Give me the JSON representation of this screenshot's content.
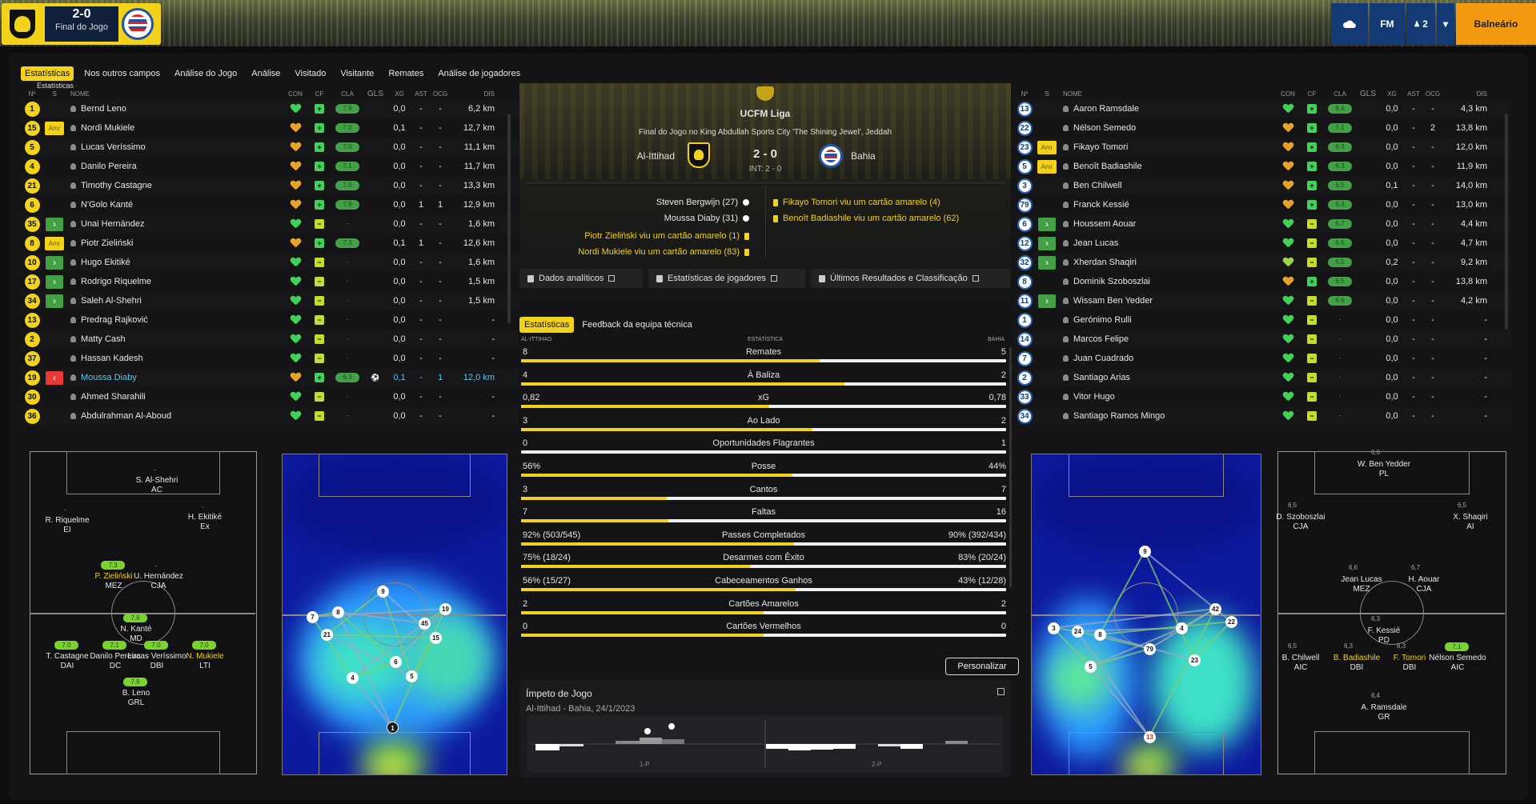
{
  "topbar": {
    "score": "2-0",
    "status": "Final do Jogo",
    "right_btn_fm": "FM",
    "right_btn_count": "2",
    "right_btn_locker": "Balneário"
  },
  "tabs": [
    "Estatísticas",
    "Nos outros campos",
    "Análise do Jogo",
    "Análise",
    "Visitado",
    "Visitante",
    "Remates",
    "Análise de jogadores"
  ],
  "table_title": "Estatísticas",
  "columns": [
    "Nº",
    "S",
    "NOME",
    "CON",
    "CF",
    "CLA",
    "GLS",
    "XG",
    "AST",
    "OCG",
    "DIS"
  ],
  "home_players": [
    {
      "no": "1",
      "s": "",
      "name": "Bernd Leno",
      "con": "g",
      "cf": "g",
      "cla": "7.9",
      "gls": "",
      "xg": "0,0",
      "ast": "-",
      "ocg": "-",
      "dis": "6,2 km"
    },
    {
      "no": "15",
      "s": "Amr",
      "name": "Nordi Mukiele",
      "con": "o",
      "cf": "g",
      "cla": "7.0",
      "gls": "",
      "xg": "0,1",
      "ast": "-",
      "ocg": "-",
      "dis": "12,7 km"
    },
    {
      "no": "5",
      "s": "",
      "name": "Lucas Veríssimo",
      "con": "o",
      "cf": "g",
      "cla": "7.0",
      "gls": "",
      "xg": "0,0",
      "ast": "-",
      "ocg": "-",
      "dis": "11,1 km"
    },
    {
      "no": "4",
      "s": "",
      "name": "Danilo Pereira",
      "con": "o",
      "cf": "g",
      "cla": "7.1",
      "gls": "",
      "xg": "0,0",
      "ast": "-",
      "ocg": "-",
      "dis": "11,7 km"
    },
    {
      "no": "21",
      "s": "",
      "name": "Timothy Castagne",
      "con": "o",
      "cf": "g",
      "cla": "7.0",
      "gls": "",
      "xg": "0,0",
      "ast": "-",
      "ocg": "-",
      "dis": "13,3 km"
    },
    {
      "no": "6",
      "s": "",
      "name": "N'Golo Kanté",
      "con": "o",
      "cf": "g",
      "cla": "7.9",
      "gls": "",
      "xg": "0,0",
      "ast": "1",
      "ocg": "1",
      "dis": "12,9 km"
    },
    {
      "no": "35",
      "s": "in",
      "name": "Unai Hernández",
      "con": "g",
      "cf": "y",
      "cla": "-",
      "gls": "",
      "xg": "0,0",
      "ast": "-",
      "ocg": "-",
      "dis": "1,6 km"
    },
    {
      "no": "8",
      "s": "Amr",
      "name": "Piotr Zieliński",
      "con": "o",
      "cf": "g",
      "cla": "7.3",
      "gls": "",
      "xg": "0,1",
      "ast": "1",
      "ocg": "-",
      "dis": "12,6 km"
    },
    {
      "no": "10",
      "s": "in",
      "name": "Hugo Ekitiké",
      "con": "g",
      "cf": "y",
      "cla": "-",
      "gls": "",
      "xg": "0,0",
      "ast": "-",
      "ocg": "-",
      "dis": "1,6 km"
    },
    {
      "no": "17",
      "s": "in",
      "name": "Rodrigo Riquelme",
      "con": "g",
      "cf": "y",
      "cla": "-",
      "gls": "",
      "xg": "0,0",
      "ast": "-",
      "ocg": "-",
      "dis": "1,5 km"
    },
    {
      "no": "34",
      "s": "in",
      "name": "Saleh Al-Shehri",
      "con": "g",
      "cf": "y",
      "cla": "-",
      "gls": "",
      "xg": "0,0",
      "ast": "-",
      "ocg": "-",
      "dis": "1,5 km"
    },
    {
      "no": "13",
      "s": "",
      "name": "Predrag Rajković",
      "con": "g",
      "cf": "y",
      "cla": "-",
      "gls": "",
      "xg": "0,0",
      "ast": "-",
      "ocg": "-",
      "dis": "-"
    },
    {
      "no": "2",
      "s": "",
      "name": "Matty Cash",
      "con": "g",
      "cf": "y",
      "cla": "-",
      "gls": "",
      "xg": "0,0",
      "ast": "-",
      "ocg": "-",
      "dis": "-"
    },
    {
      "no": "37",
      "s": "",
      "name": "Hassan Kadesh",
      "con": "g",
      "cf": "y",
      "cla": "-",
      "gls": "",
      "xg": "0,0",
      "ast": "-",
      "ocg": "-",
      "dis": "-"
    },
    {
      "no": "19",
      "s": "out",
      "name": "Moussa Diaby",
      "con": "o",
      "cf": "g",
      "cla": "6.3",
      "gls": "ball",
      "xg": "0,1",
      "ast": "-",
      "ocg": "1",
      "dis": "12,0 km",
      "hl": true
    },
    {
      "no": "30",
      "s": "",
      "name": "Ahmed Sharahili",
      "con": "g",
      "cf": "y",
      "cla": "-",
      "gls": "",
      "xg": "0,0",
      "ast": "-",
      "ocg": "-",
      "dis": "-"
    },
    {
      "no": "36",
      "s": "",
      "name": "Abdulrahman Al-Aboud",
      "con": "g",
      "cf": "y",
      "cla": "-",
      "gls": "",
      "xg": "0,0",
      "ast": "-",
      "ocg": "-",
      "dis": "-"
    }
  ],
  "away_players": [
    {
      "no": "13",
      "s": "",
      "name": "Aaron Ramsdale",
      "con": "g",
      "cf": "g",
      "cla": "6.4",
      "gls": "",
      "xg": "0,0",
      "ast": "-",
      "ocg": "-",
      "dis": "4,3 km"
    },
    {
      "no": "22",
      "s": "",
      "name": "Nélson Semedo",
      "con": "o",
      "cf": "g",
      "cla": "7.1",
      "gls": "",
      "xg": "0,0",
      "ast": "-",
      "ocg": "2",
      "dis": "13,8 km"
    },
    {
      "no": "23",
      "s": "Amr",
      "name": "Fikayo Tomori",
      "con": "o",
      "cf": "g",
      "cla": "6.3",
      "gls": "",
      "xg": "0,0",
      "ast": "-",
      "ocg": "-",
      "dis": "12,0 km"
    },
    {
      "no": "5",
      "s": "Amr",
      "name": "Benoît Badiashile",
      "con": "o",
      "cf": "g",
      "cla": "6.3",
      "gls": "",
      "xg": "0,0",
      "ast": "-",
      "ocg": "-",
      "dis": "11,9 km"
    },
    {
      "no": "3",
      "s": "",
      "name": "Ben Chilwell",
      "con": "o",
      "cf": "g",
      "cla": "6.5",
      "gls": "",
      "xg": "0,1",
      "ast": "-",
      "ocg": "-",
      "dis": "14,0 km"
    },
    {
      "no": "79",
      "s": "",
      "name": "Franck Kessié",
      "con": "o",
      "cf": "g",
      "cla": "6.3",
      "gls": "",
      "xg": "0,0",
      "ast": "-",
      "ocg": "-",
      "dis": "13,0 km"
    },
    {
      "no": "6",
      "s": "in",
      "name": "Houssem Aouar",
      "con": "g",
      "cf": "y",
      "cla": "6.7",
      "gls": "",
      "xg": "0,0",
      "ast": "-",
      "ocg": "-",
      "dis": "4,4 km"
    },
    {
      "no": "12",
      "s": "in",
      "name": "Jean Lucas",
      "con": "g",
      "cf": "y",
      "cla": "6.6",
      "gls": "",
      "xg": "0,0",
      "ast": "-",
      "ocg": "-",
      "dis": "4,7 km"
    },
    {
      "no": "32",
      "s": "in",
      "name": "Xherdan Shaqiri",
      "con": "lg",
      "cf": "y",
      "cla": "6.5",
      "gls": "",
      "xg": "0,2",
      "ast": "-",
      "ocg": "-",
      "dis": "9,2 km"
    },
    {
      "no": "8",
      "s": "",
      "name": "Dominik Szoboszlai",
      "con": "o",
      "cf": "g",
      "cla": "6.5",
      "gls": "",
      "xg": "0,0",
      "ast": "-",
      "ocg": "-",
      "dis": "13,8 km"
    },
    {
      "no": "11",
      "s": "in",
      "name": "Wissam Ben Yedder",
      "con": "g",
      "cf": "y",
      "cla": "6.6",
      "gls": "",
      "xg": "0,0",
      "ast": "-",
      "ocg": "-",
      "dis": "4,2 km"
    },
    {
      "no": "1",
      "s": "",
      "name": "Gerónimo Rulli",
      "con": "g",
      "cf": "y",
      "cla": "-",
      "gls": "",
      "xg": "0,0",
      "ast": "-",
      "ocg": "-",
      "dis": "-"
    },
    {
      "no": "14",
      "s": "",
      "name": "Marcos Felipe",
      "con": "g",
      "cf": "y",
      "cla": "-",
      "gls": "",
      "xg": "0,0",
      "ast": "-",
      "ocg": "-",
      "dis": "-"
    },
    {
      "no": "7",
      "s": "",
      "name": "Juan Cuadrado",
      "con": "g",
      "cf": "y",
      "cla": "-",
      "gls": "",
      "xg": "0,0",
      "ast": "-",
      "ocg": "-",
      "dis": "-"
    },
    {
      "no": "2",
      "s": "",
      "name": "Santiago Arias",
      "con": "g",
      "cf": "y",
      "cla": "-",
      "gls": "",
      "xg": "0,0",
      "ast": "-",
      "ocg": "-",
      "dis": "-"
    },
    {
      "no": "33",
      "s": "",
      "name": "Vitor Hugo",
      "con": "g",
      "cf": "y",
      "cla": "-",
      "gls": "",
      "xg": "0,0",
      "ast": "-",
      "ocg": "-",
      "dis": "-"
    },
    {
      "no": "34",
      "s": "",
      "name": "Santiago Ramos Mingo",
      "con": "g",
      "cf": "y",
      "cla": "-",
      "gls": "",
      "xg": "0,0",
      "ast": "-",
      "ocg": "-",
      "dis": "-"
    }
  ],
  "match": {
    "league": "UCFM Liga",
    "venue": "Final do Jogo no King Abdullah Sports City 'The Shining Jewel', Jeddah",
    "home": "Al-Ittihad",
    "away": "Bahia",
    "score": "2 - 0",
    "interval": "INT: 2 - 0",
    "events_home": [
      "Steven Bergwijn (27)",
      "Moussa Diaby (31)",
      "Piotr Zieliński viu um cartão amarelo (1)",
      "Nordi Mukiele viu um cartão amarelo (83)"
    ],
    "events_away": [
      "Fikayo Tomori viu um cartão amarelo (4)",
      "Benoît Badiashile viu um cartão amarelo (62)"
    ],
    "links": [
      "Dados analíticos",
      "Estatísticas de jogadores",
      "Últimos Resultados e Classificação"
    ]
  },
  "stats_tabs": [
    "Estatísticas",
    "Feedback da equipa técnica"
  ],
  "stats_head": {
    "home": "AL-ITTIHAD",
    "mid": "ESTATÍSTICA",
    "away": "BAHIA"
  },
  "stats": [
    {
      "label": "Remates",
      "home": "8",
      "away": "5",
      "share": 0.615
    },
    {
      "label": "À Baliza",
      "home": "4",
      "away": "2",
      "share": 0.667
    },
    {
      "label": "xG",
      "home": "0,82",
      "away": "0,78",
      "share": 0.512
    },
    {
      "label": "Ao Lado",
      "home": "3",
      "away": "2",
      "share": 0.6
    },
    {
      "label": "Oportunidades Flagrantes",
      "home": "0",
      "away": "1",
      "share": 0.0
    },
    {
      "label": "Posse",
      "home": "56%",
      "away": "44%",
      "share": 0.56
    },
    {
      "label": "Cantos",
      "home": "3",
      "away": "7",
      "share": 0.3
    },
    {
      "label": "Faltas",
      "home": "7",
      "away": "16",
      "share": 0.304
    },
    {
      "label": "Passes Completados",
      "home": "92% (503/545)",
      "away": "90% (392/434)",
      "share": 0.562
    },
    {
      "label": "Desarmes com Êxito",
      "home": "75% (18/24)",
      "away": "83% (20/24)",
      "share": 0.474
    },
    {
      "label": "Cabeceamentos Ganhos",
      "home": "56% (15/27)",
      "away": "43% (12/28)",
      "share": 0.566
    },
    {
      "label": "Cartões Amarelos",
      "home": "2",
      "away": "2",
      "share": 0.5
    },
    {
      "label": "Cartões Vermelhos",
      "home": "0",
      "away": "0",
      "share": 0.5
    }
  ],
  "customize_label": "Personalizar",
  "momentum": {
    "title": "Ímpeto de Jogo",
    "subtitle": "Al-Ittihad - Bahia, 24/1/2023",
    "half1": "1-P",
    "half2": "2-P"
  },
  "home_formation": [
    {
      "name": "S. Al-Shehri",
      "pos": "AC",
      "rating": "-",
      "y": false
    },
    {
      "name": "R. Riquelme",
      "pos": "EI",
      "rating": "-",
      "y": false
    },
    {
      "name": "H. Ekitiké",
      "pos": "Ex",
      "rating": "-",
      "y": false
    },
    {
      "name": "P. Zieliński",
      "pos": "MEZ",
      "rating": "7.3",
      "y": true
    },
    {
      "name": "U. Hernández",
      "pos": "CJA",
      "rating": "-",
      "y": false
    },
    {
      "name": "N. Kanté",
      "pos": "MD",
      "rating": "7.9",
      "y": false
    },
    {
      "name": "T. Castagne",
      "pos": "DAI",
      "rating": "7.0",
      "y": false
    },
    {
      "name": "Danilo Pereira",
      "pos": "DC",
      "rating": "7.1",
      "y": false
    },
    {
      "name": "Lucas Veríssimo",
      "pos": "DBI",
      "rating": "7.0",
      "y": false
    },
    {
      "name": "N. Mukiele",
      "pos": "LTI",
      "rating": "7.0",
      "y": true
    },
    {
      "name": "B. Leno",
      "pos": "GRL",
      "rating": "7.9",
      "y": false
    }
  ],
  "away_formation": [
    {
      "name": "W. Ben Yedder",
      "pos": "PL",
      "rating": "6,6",
      "y": false
    },
    {
      "name": "D. Szoboszlai",
      "pos": "CJA",
      "rating": "6,5",
      "y": false
    },
    {
      "name": "X. Shaqiri",
      "pos": "AI",
      "rating": "6,5",
      "y": false
    },
    {
      "name": "Jean Lucas",
      "pos": "MEZ",
      "rating": "6,6",
      "y": false
    },
    {
      "name": "H. Aouar",
      "pos": "CJA",
      "rating": "6,7",
      "y": false
    },
    {
      "name": "F. Kessié",
      "pos": "PD",
      "rating": "6,3",
      "y": false
    },
    {
      "name": "B. Chilwell",
      "pos": "AIC",
      "rating": "6,5",
      "y": false
    },
    {
      "name": "B. Badiashile",
      "pos": "DBI",
      "rating": "6,3",
      "y": true
    },
    {
      "name": "F. Tomori",
      "pos": "DBI",
      "rating": "6,3",
      "y": true
    },
    {
      "name": "Nélson Semedo",
      "pos": "AIC",
      "rating": "7.1",
      "y": false
    },
    {
      "name": "A. Ramsdale",
      "pos": "GR",
      "rating": "6,4",
      "y": false
    }
  ],
  "home_heat_nodes": [
    "9",
    "7",
    "8",
    "21",
    "45",
    "19",
    "15",
    "6",
    "4",
    "5",
    "1"
  ],
  "away_heat_nodes": [
    "9",
    "3",
    "24",
    "8",
    "4",
    "42",
    "22",
    "79",
    "5",
    "23",
    "13"
  ],
  "colors": {
    "accent": "#f2d21b",
    "home_blue": "#143a76",
    "orange": "#f39a10",
    "green": "#43d15a"
  }
}
